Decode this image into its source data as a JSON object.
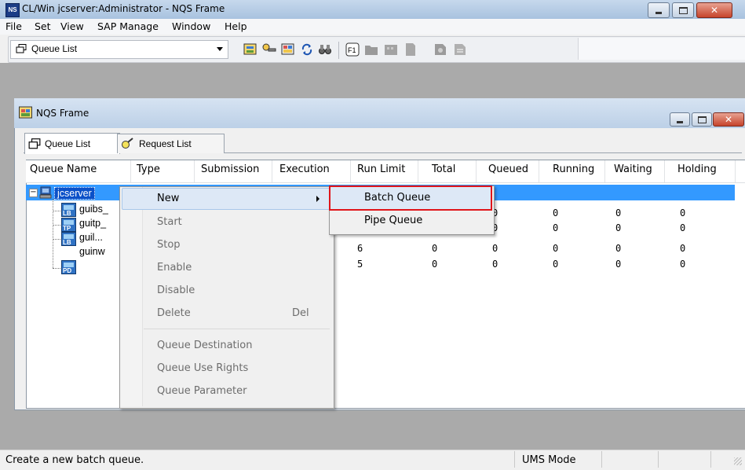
{
  "window": {
    "title": "CL/Win jcserver:Administrator - NQS Frame",
    "icon_text": "NS"
  },
  "menubar": [
    "File",
    "Set",
    "View",
    "SAP Manage",
    "Window",
    "Help"
  ],
  "toolbar": {
    "combo_value": "Queue List"
  },
  "inner_window": {
    "title": "NQS Frame"
  },
  "tabs": [
    {
      "label": "Queue List",
      "icon": "queue-list-icon",
      "active": true
    },
    {
      "label": "Request List",
      "icon": "request-list-icon",
      "active": false
    }
  ],
  "columns": [
    "Queue Name",
    "Type",
    "Submission",
    "Execution",
    "Run Limit",
    "Total",
    "Queued",
    "Running",
    "Waiting",
    "Holding"
  ],
  "tree": {
    "root": "jcserver",
    "queues": [
      {
        "name": "guibs_",
        "icon_label": "LB"
      },
      {
        "name": "guitp_",
        "icon_label": "TP"
      },
      {
        "name": "guil...",
        "icon_label": "LB"
      },
      {
        "name": "guinw",
        "icon_label": "PD"
      }
    ]
  },
  "rows": [
    {
      "run_limit": "",
      "total": "",
      "queued": "0",
      "running": "0",
      "waiting": "0",
      "holding": "0"
    },
    {
      "run_limit": "",
      "total": "",
      "queued": "0",
      "running": "0",
      "waiting": "0",
      "holding": "0"
    },
    {
      "run_limit": "6",
      "total": "0",
      "queued": "0",
      "running": "0",
      "waiting": "0",
      "holding": "0"
    },
    {
      "run_limit": "5",
      "total": "0",
      "queued": "0",
      "running": "0",
      "waiting": "0",
      "holding": "0"
    }
  ],
  "context_menu": {
    "new": "New",
    "start": "Start",
    "stop": "Stop",
    "enable": "Enable",
    "disable": "Disable",
    "delete": "Delete",
    "delete_shortcut": "Del",
    "queue_destination": "Queue Destination",
    "queue_use_rights": "Queue Use Rights",
    "queue_parameter": "Queue Parameter"
  },
  "submenu": {
    "batch_queue": "Batch Queue",
    "pipe_queue": "Pipe Queue"
  },
  "status": {
    "message": "Create a new batch queue.",
    "mode": "UMS Mode"
  },
  "colors": {
    "selection": "#3399ff",
    "highlight_border": "#e0151a"
  }
}
